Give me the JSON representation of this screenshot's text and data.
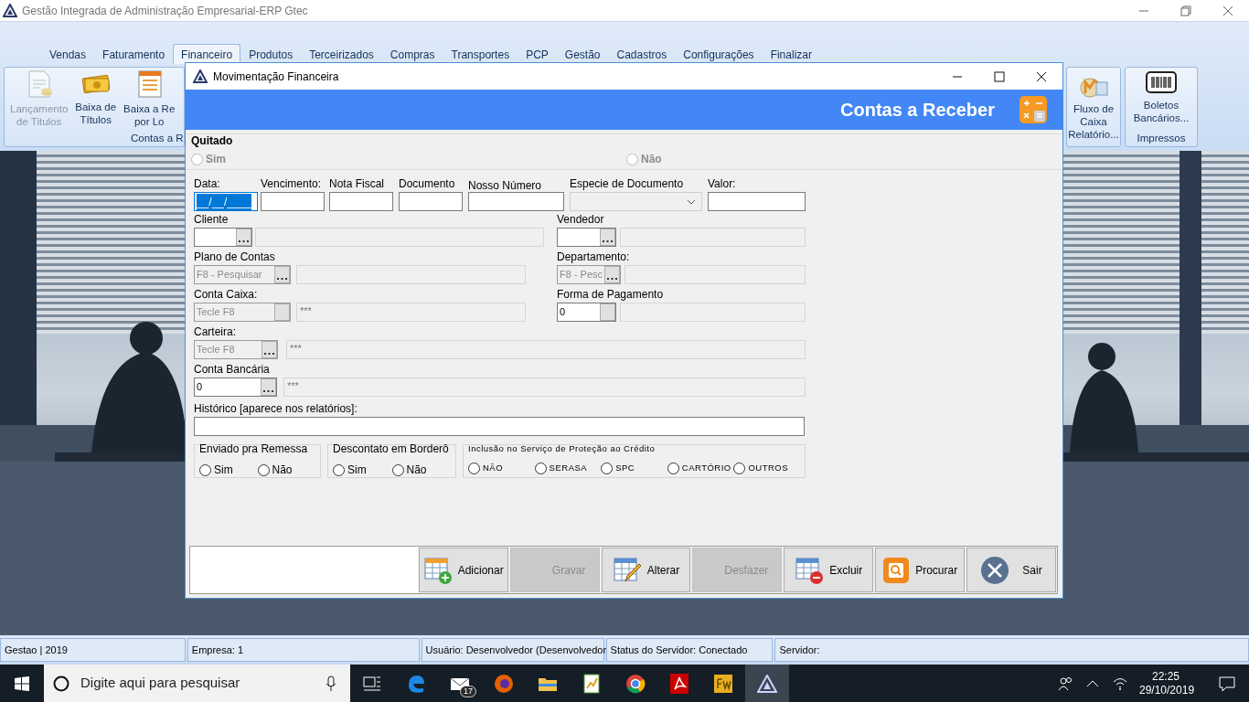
{
  "app": {
    "title": "Gestão Integrada de Administração Empresarial-ERP Gtec"
  },
  "ribbon": {
    "tabs": [
      {
        "label": "Vendas",
        "selected": false
      },
      {
        "label": "Faturamento",
        "selected": false
      },
      {
        "label": "Financeiro",
        "selected": true
      },
      {
        "label": "Produtos",
        "selected": false
      },
      {
        "label": "Terceirizados",
        "selected": false
      },
      {
        "label": "Compras",
        "selected": false
      },
      {
        "label": "Transportes",
        "selected": false
      },
      {
        "label": "PCP",
        "selected": false
      },
      {
        "label": "Gestão",
        "selected": false
      },
      {
        "label": "Cadastros",
        "selected": false
      },
      {
        "label": "Configurações",
        "selected": false
      },
      {
        "label": "Finalizar",
        "selected": false
      }
    ],
    "left_group": {
      "label": "Contas a R",
      "items": [
        {
          "kind": "ledger",
          "lines": [
            "Lançamento",
            "de Titulos"
          ],
          "disabled": true
        },
        {
          "kind": "cash",
          "lines": [
            "Baixa de",
            "Títulos"
          ],
          "disabled": false
        },
        {
          "kind": "form",
          "lines": [
            "Baixa a Re",
            "por Lo"
          ],
          "disabled": false
        }
      ]
    },
    "right_groups": [
      {
        "items": [
          {
            "kind": "cashflow",
            "lines": [
              "Fluxo de",
              "Caixa",
              "Relatório..."
            ],
            "disabled": false
          }
        ]
      },
      {
        "label": "Impressos",
        "items": [
          {
            "kind": "barcode",
            "lines": [
              "Boletos",
              "Bancários..."
            ],
            "disabled": false
          }
        ]
      }
    ]
  },
  "dialog": {
    "title": "Movimentação Financeira",
    "header": "Contas a Receber",
    "quitado": {
      "label": "Quitado",
      "disabled": true,
      "options": [
        {
          "label": "Sim",
          "selected": false
        },
        {
          "label": "Não",
          "selected": false
        }
      ]
    },
    "fields": [
      {
        "kind": "date",
        "label": "Data:",
        "value": "__/__/____",
        "highlighted": true
      },
      {
        "kind": "text",
        "label": "Vencimento:"
      },
      {
        "kind": "text",
        "label": "Nota Fiscal"
      },
      {
        "kind": "text",
        "label": "Documento"
      },
      {
        "kind": "text",
        "label": "Nosso Número"
      },
      {
        "kind": "select",
        "label": "Especie de Documento",
        "disabled": true
      },
      {
        "kind": "text",
        "label": "Valor:"
      }
    ],
    "lookup_rows": [
      [
        {
          "label": "Cliente",
          "disabled": false,
          "button_disabled": false
        },
        {
          "label": "Vendedor",
          "disabled": false,
          "button_disabled": false
        }
      ],
      [
        {
          "label": "Plano de Contas",
          "placeholder": "F8 - Pesquisar",
          "disabled": true,
          "button_disabled": false
        },
        {
          "label": "Departamento:",
          "placeholder": "F8 - Pesc",
          "disabled": true,
          "button_disabled": false
        }
      ],
      [
        {
          "label": "Conta Caixa:",
          "placeholder": "Tecle F8",
          "description": "***",
          "disabled": true,
          "button_disabled": true
        },
        {
          "label": "Forma de Pagamento",
          "value": "0",
          "disabled": false,
          "button_disabled": true
        }
      ],
      [
        {
          "label": "Carteira:",
          "placeholder": "Tecle F8",
          "description": "***",
          "disabled": true,
          "button_disabled": false
        }
      ],
      [
        {
          "label": "Conta Bancária",
          "value": "0",
          "description": "***",
          "disabled": false,
          "button_disabled": false
        }
      ]
    ],
    "history": {
      "label": "Histórico [aparece nos relatórios]:"
    },
    "groups": [
      {
        "kind": "normal",
        "title": "Enviado pra Remessa",
        "options": [
          {
            "label": "Sim",
            "selected": false
          },
          {
            "label": "Não",
            "selected": false
          }
        ]
      },
      {
        "kind": "normal",
        "title": "Descontato em Borderô",
        "options": [
          {
            "label": "Sim",
            "selected": false
          },
          {
            "label": "Não",
            "selected": false
          }
        ]
      },
      {
        "kind": "compact",
        "title": "Inclusão no Serviço de Proteção ao Crédito",
        "options": [
          {
            "label": "NÃO",
            "selected": false
          },
          {
            "label": "SERASA",
            "selected": false
          },
          {
            "label": "SPC",
            "selected": false
          },
          {
            "label": "CARTÓRIO",
            "selected": false
          },
          {
            "label": "OUTROS",
            "selected": false
          }
        ]
      }
    ],
    "buttons": [
      {
        "kind": "add",
        "label": "Adicionar",
        "disabled": false
      },
      {
        "label": "Gravar",
        "disabled": true
      },
      {
        "kind": "edit",
        "label": "Alterar",
        "disabled": false
      },
      {
        "label": "Desfazer",
        "disabled": true
      },
      {
        "kind": "delete",
        "label": "Excluir",
        "disabled": false
      },
      {
        "kind": "search",
        "label": "Procurar",
        "disabled": false
      },
      {
        "kind": "exit",
        "label": "Sair",
        "disabled": false
      }
    ]
  },
  "status_bar": [
    "Gestao | 2019",
    "Empresa: 1",
    "Usuário: Desenvolvedor (Desenvolvedor",
    "Status do Servidor: Conectado",
    "Servidor:"
  ],
  "taskbar": {
    "search_placeholder": "Digite aqui para pesquisar",
    "apps": [
      {
        "kind": "taskview",
        "selected": false
      },
      {
        "kind": "edge",
        "selected": false
      },
      {
        "kind": "mail",
        "badge": "17",
        "selected": false
      },
      {
        "kind": "firefox",
        "selected": false
      },
      {
        "kind": "explorer",
        "selected": false
      },
      {
        "kind": "spreadsheet",
        "selected": false
      },
      {
        "kind": "chrome",
        "selected": false
      },
      {
        "kind": "acrobat",
        "selected": false
      },
      {
        "kind": "fireworks",
        "selected": false
      },
      {
        "kind": "gtec",
        "selected": true
      }
    ],
    "time": "22:25",
    "date": "29/10/2019"
  }
}
